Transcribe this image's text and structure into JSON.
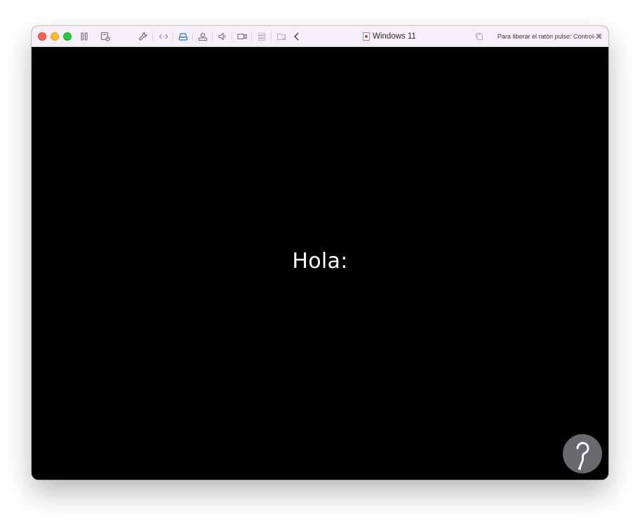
{
  "window": {
    "title": "Windows 11",
    "release_hint": "Para liberar el ratón pulse: Control-⌘"
  },
  "toolbar": {
    "icons": [
      "pause-icon",
      "snapshot-icon",
      "settings-wrench-icon",
      "code-arrows-icon",
      "drive-icon",
      "user-share-icon",
      "speaker-icon",
      "camera-icon",
      "usb-stack-icon",
      "shared-folder-icon",
      "chevron-left-icon",
      "copy-icon"
    ],
    "active_color": "#1a73e8"
  },
  "screen": {
    "greeting": "Hola:",
    "background": "#000000"
  },
  "watermark": {
    "icon": "logo-icon",
    "color": "#7a7a82"
  }
}
